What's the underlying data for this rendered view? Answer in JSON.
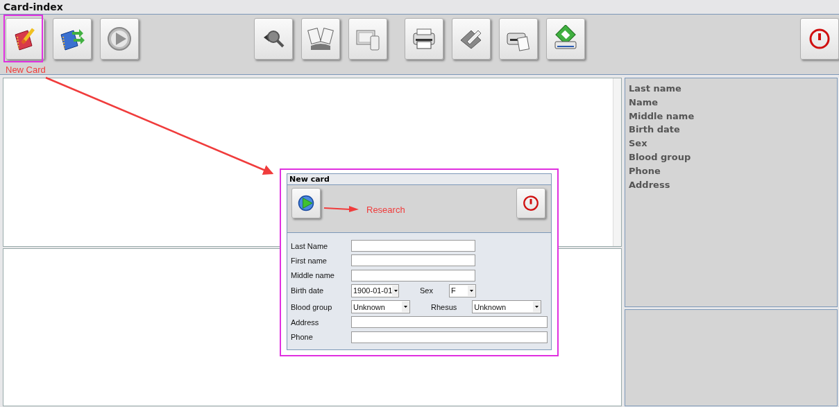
{
  "window": {
    "title": "Card-index"
  },
  "toolbar": {
    "groups": [
      {
        "buttons": [
          {
            "highlighted": true,
            "note": "New Card"
          },
          {
            "highlighted": false
          },
          {
            "highlighted": false
          }
        ]
      },
      {
        "buttons": [
          {
            "highlighted": false
          },
          {
            "highlighted": false
          },
          {
            "highlighted": false
          }
        ]
      },
      {
        "buttons": [
          {
            "highlighted": false
          },
          {
            "highlighted": false
          },
          {
            "highlighted": false
          },
          {
            "highlighted": false
          }
        ]
      },
      {
        "buttons": [
          {
            "highlighted": false
          }
        ]
      }
    ]
  },
  "details": {
    "labels": [
      "Last name",
      "Name",
      "Middle name",
      "Birth date",
      "Sex",
      "Blood group",
      "Phone",
      "Address"
    ]
  },
  "dialog": {
    "title": "New card",
    "note": "Research",
    "rows": [
      {
        "kind": "text",
        "label": "Last Name",
        "wide": false
      },
      {
        "kind": "text",
        "label": "First name",
        "wide": false
      },
      {
        "kind": "text",
        "label": "Middle name",
        "wide": false
      },
      {
        "kind": "selects",
        "items": [
          {
            "label": "Birth date",
            "value": "1900-01-01"
          },
          {
            "label": "Sex",
            "value": "F"
          }
        ]
      },
      {
        "kind": "selects",
        "items": [
          {
            "label": "Blood group",
            "value": "Unknown"
          },
          {
            "label": "Rhesus",
            "value": "Unknown"
          }
        ]
      },
      {
        "kind": "text",
        "label": "Address",
        "wide": true
      },
      {
        "kind": "text",
        "label": "Phone",
        "wide": true
      }
    ]
  }
}
